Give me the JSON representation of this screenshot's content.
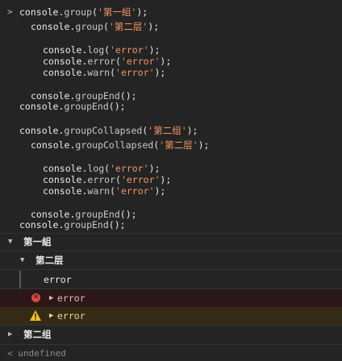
{
  "prompt_symbol": ">",
  "code_lines": [
    {
      "obj": "console.",
      "fn": "group",
      "open": "(",
      "str": "'第一組'",
      "close": ");"
    },
    {
      "obj": "console.",
      "fn": "group",
      "open": "(",
      "str": "'第二层'",
      "close": ");"
    },
    {
      "obj": "console.",
      "fn": "log",
      "open": "(",
      "str": "'error'",
      "close": ");"
    },
    {
      "obj": "console.",
      "fn": "error",
      "open": "(",
      "str": "'error'",
      "close": ");"
    },
    {
      "obj": "console.",
      "fn": "warn",
      "open": "(",
      "str": "'error'",
      "close": ");"
    },
    {
      "obj": "console.",
      "fn": "groupEnd",
      "open": "(",
      "str": "",
      "close": ");"
    },
    {
      "obj": "console.",
      "fn": "groupEnd",
      "open": "(",
      "str": "",
      "close": ");"
    },
    {
      "obj": "console.",
      "fn": "groupCollapsed",
      "open": "(",
      "str": "'第二组'",
      "close": ");"
    },
    {
      "obj": "console.",
      "fn": "groupCollapsed",
      "open": "(",
      "str": "'第二层'",
      "close": ");"
    },
    {
      "obj": "console.",
      "fn": "log",
      "open": "(",
      "str": "'error'",
      "close": ");"
    },
    {
      "obj": "console.",
      "fn": "error",
      "open": "(",
      "str": "'error'",
      "close": ");"
    },
    {
      "obj": "console.",
      "fn": "warn",
      "open": "(",
      "str": "'error'",
      "close": ");"
    },
    {
      "obj": "console.",
      "fn": "groupEnd",
      "open": "(",
      "str": "",
      "close": ");"
    },
    {
      "obj": "console.",
      "fn": "groupEnd",
      "open": "(",
      "str": "",
      "close": ");"
    }
  ],
  "output": {
    "group1_label": "第一組",
    "group1_toggle": "▼",
    "group2_label": "第二层",
    "group2_toggle": "▼",
    "log_text": "error",
    "error_text": "error",
    "error_expand": "▶",
    "warn_text": "error",
    "warn_expand": "▶",
    "collapsed_label": "第二组",
    "collapsed_toggle": "▶",
    "result_arrow": "<",
    "result_text": "undefined"
  },
  "colors": {
    "background": "#242424",
    "string": "#f29766",
    "error_bg": "#2b1718",
    "warn_bg": "#332b16",
    "error_icon": "#e2483d",
    "warn_icon": "#f4bf2a"
  }
}
